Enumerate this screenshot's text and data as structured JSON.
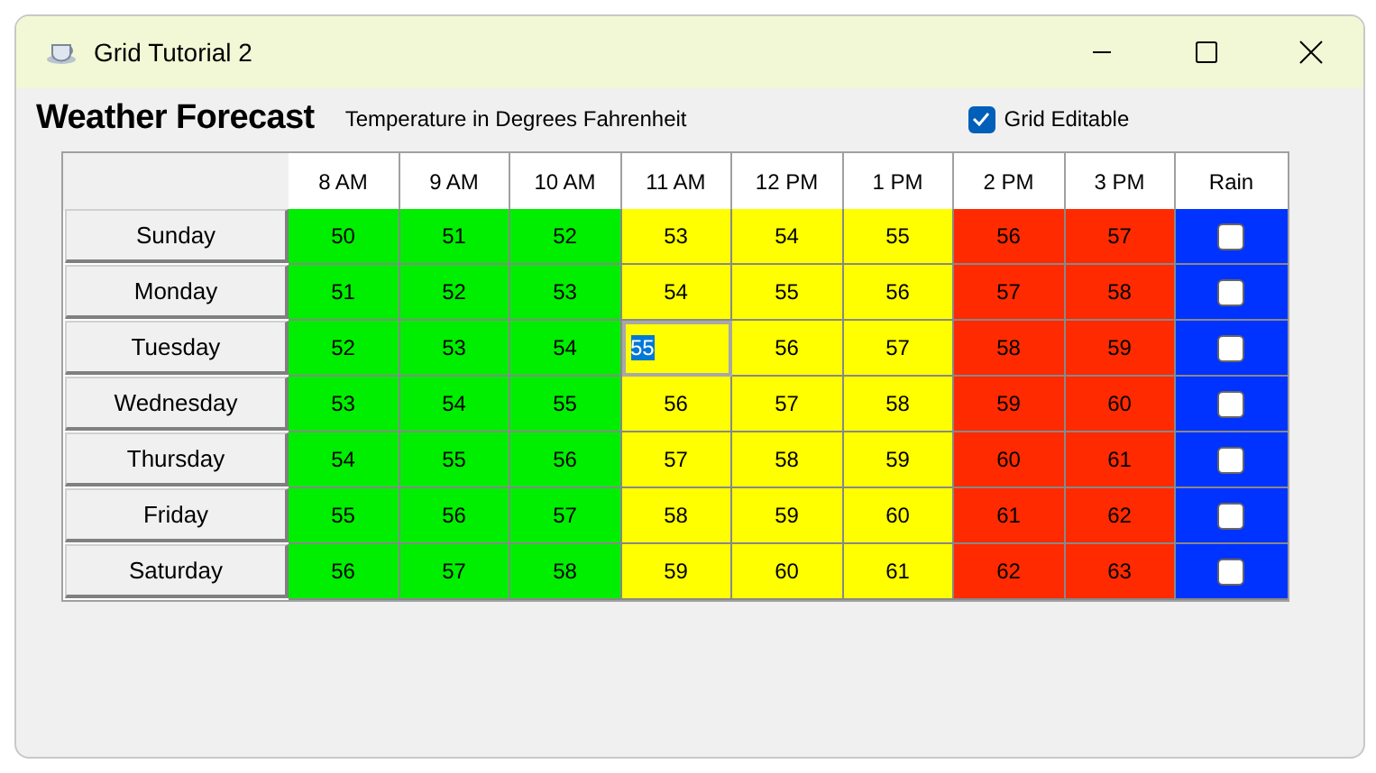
{
  "window": {
    "title": "Grid Tutorial 2"
  },
  "heading": "Weather Forecast",
  "subtitle": "Temperature in Degrees Fahrenheit",
  "grid_editable": {
    "label": "Grid Editable",
    "checked": true
  },
  "columns": [
    "8 AM",
    "9 AM",
    "10 AM",
    "11 AM",
    "12 PM",
    "1 PM",
    "2 PM",
    "3 PM"
  ],
  "rain_column": "Rain",
  "rows": [
    {
      "day": "Sunday",
      "rain": false,
      "cells": [
        {
          "text": "50",
          "color": "#00ee00",
          "selected": false
        },
        {
          "text": "51",
          "color": "#00ee00",
          "selected": false
        },
        {
          "text": "52",
          "color": "#00ee00",
          "selected": false
        },
        {
          "text": "53",
          "color": "#ffff00",
          "selected": false
        },
        {
          "text": "54",
          "color": "#ffff00",
          "selected": false
        },
        {
          "text": "55",
          "color": "#ffff00",
          "selected": false
        },
        {
          "text": "56",
          "color": "#ff2a00",
          "selected": false
        },
        {
          "text": "57",
          "color": "#ff2a00",
          "selected": false
        }
      ]
    },
    {
      "day": "Monday",
      "rain": false,
      "cells": [
        {
          "text": "51",
          "color": "#00ee00",
          "selected": false
        },
        {
          "text": "52",
          "color": "#00ee00",
          "selected": false
        },
        {
          "text": "53",
          "color": "#00ee00",
          "selected": false
        },
        {
          "text": "54",
          "color": "#ffff00",
          "selected": false
        },
        {
          "text": "55",
          "color": "#ffff00",
          "selected": false
        },
        {
          "text": "56",
          "color": "#ffff00",
          "selected": false
        },
        {
          "text": "57",
          "color": "#ff2a00",
          "selected": false
        },
        {
          "text": "58",
          "color": "#ff2a00",
          "selected": false
        }
      ]
    },
    {
      "day": "Tuesday",
      "rain": false,
      "cells": [
        {
          "text": "52",
          "color": "#00ee00",
          "selected": false
        },
        {
          "text": "53",
          "color": "#00ee00",
          "selected": false
        },
        {
          "text": "54",
          "color": "#00ee00",
          "selected": false
        },
        {
          "text": "55",
          "color": "#ffff00",
          "selected": true
        },
        {
          "text": "56",
          "color": "#ffff00",
          "selected": false
        },
        {
          "text": "57",
          "color": "#ffff00",
          "selected": false
        },
        {
          "text": "58",
          "color": "#ff2a00",
          "selected": false
        },
        {
          "text": "59",
          "color": "#ff2a00",
          "selected": false
        }
      ]
    },
    {
      "day": "Wednesday",
      "rain": false,
      "cells": [
        {
          "text": "53",
          "color": "#00ee00",
          "selected": false
        },
        {
          "text": "54",
          "color": "#00ee00",
          "selected": false
        },
        {
          "text": "55",
          "color": "#00ee00",
          "selected": false
        },
        {
          "text": "56",
          "color": "#ffff00",
          "selected": false
        },
        {
          "text": "57",
          "color": "#ffff00",
          "selected": false
        },
        {
          "text": "58",
          "color": "#ffff00",
          "selected": false
        },
        {
          "text": "59",
          "color": "#ff2a00",
          "selected": false
        },
        {
          "text": "60",
          "color": "#ff2a00",
          "selected": false
        }
      ]
    },
    {
      "day": "Thursday",
      "rain": false,
      "cells": [
        {
          "text": "54",
          "color": "#00ee00",
          "selected": false
        },
        {
          "text": "55",
          "color": "#00ee00",
          "selected": false
        },
        {
          "text": "56",
          "color": "#00ee00",
          "selected": false
        },
        {
          "text": "57",
          "color": "#ffff00",
          "selected": false
        },
        {
          "text": "58",
          "color": "#ffff00",
          "selected": false
        },
        {
          "text": "59",
          "color": "#ffff00",
          "selected": false
        },
        {
          "text": "60",
          "color": "#ff2a00",
          "selected": false
        },
        {
          "text": "61",
          "color": "#ff2a00",
          "selected": false
        }
      ]
    },
    {
      "day": "Friday",
      "rain": false,
      "cells": [
        {
          "text": "55",
          "color": "#00ee00",
          "selected": false
        },
        {
          "text": "56",
          "color": "#00ee00",
          "selected": false
        },
        {
          "text": "57",
          "color": "#00ee00",
          "selected": false
        },
        {
          "text": "58",
          "color": "#ffff00",
          "selected": false
        },
        {
          "text": "59",
          "color": "#ffff00",
          "selected": false
        },
        {
          "text": "60",
          "color": "#ffff00",
          "selected": false
        },
        {
          "text": "61",
          "color": "#ff2a00",
          "selected": false
        },
        {
          "text": "62",
          "color": "#ff2a00",
          "selected": false
        }
      ]
    },
    {
      "day": "Saturday",
      "rain": false,
      "cells": [
        {
          "text": "56",
          "color": "#00ee00",
          "selected": false
        },
        {
          "text": "57",
          "color": "#00ee00",
          "selected": false
        },
        {
          "text": "58",
          "color": "#00ee00",
          "selected": false
        },
        {
          "text": "59",
          "color": "#ffff00",
          "selected": false
        },
        {
          "text": "60",
          "color": "#ffff00",
          "selected": false
        },
        {
          "text": "61",
          "color": "#ffff00",
          "selected": false
        },
        {
          "text": "62",
          "color": "#ff2a00",
          "selected": false
        },
        {
          "text": "63",
          "color": "#ff2a00",
          "selected": false
        }
      ]
    }
  ]
}
